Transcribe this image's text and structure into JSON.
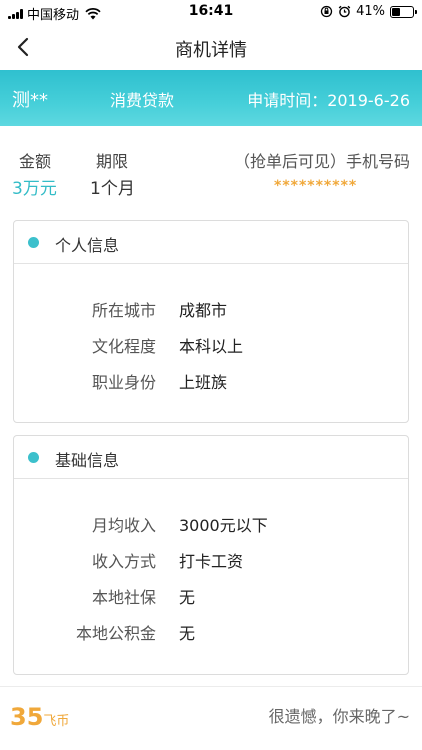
{
  "status_bar": {
    "carrier": "中国移动",
    "time": "16:41",
    "battery_percent": "41%",
    "battery_level": 0.41,
    "icons": [
      "signal-icon",
      "wifi-icon",
      "orientation-lock-icon",
      "alarm-icon",
      "battery-icon"
    ]
  },
  "nav": {
    "back_icon": "chevron-left-icon",
    "title": "商机详情"
  },
  "header": {
    "name": "测**",
    "loan_type": "消费贷款",
    "apply_time": "申请时间：2019-6-26",
    "colors": {
      "band": "#46cfd9"
    }
  },
  "summary": {
    "amount_label": "金额",
    "amount_value": "3万元",
    "term_label": "期限",
    "term_value": "1个月",
    "phone_label": "（抢单后可见）手机号码",
    "phone_value": "**********"
  },
  "personal_info": {
    "title": "个人信息",
    "rows": [
      {
        "label": "所在城市",
        "value": "成都市"
      },
      {
        "label": "文化程度",
        "value": "本科以上"
      },
      {
        "label": "职业身份",
        "value": "上班族"
      }
    ]
  },
  "basic_info": {
    "title": "基础信息",
    "rows": [
      {
        "label": "月均收入",
        "value": "3000元以下"
      },
      {
        "label": "收入方式",
        "value": "打卡工资"
      },
      {
        "label": "本地社保",
        "value": "无"
      },
      {
        "label": "本地公积金",
        "value": "无"
      }
    ]
  },
  "footer": {
    "coins_amount": "35",
    "coins_unit": "飞币",
    "message": "很遗憾，你来晚了~"
  },
  "colors": {
    "accent": "#3cc0cc",
    "coin": "#f0a83a"
  }
}
